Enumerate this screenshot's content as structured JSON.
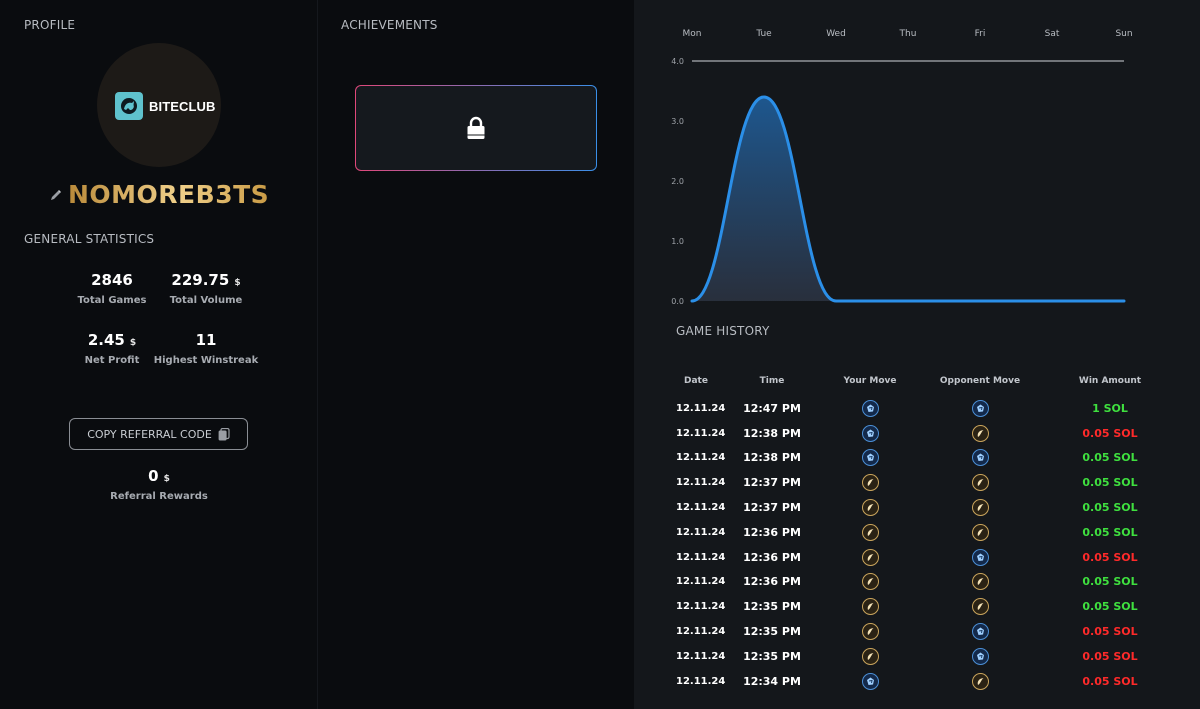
{
  "profile": {
    "section_title": "PROFILE",
    "logo_text": "BITECLUB",
    "username": "NOMOREB3TS",
    "stats_title": "GENERAL STATISTICS",
    "stats": [
      {
        "value": "2846",
        "label": "Total Games",
        "sol": false
      },
      {
        "value": "229.75",
        "label": "Total Volume",
        "sol": true
      },
      {
        "value": "2.45",
        "label": "Net Profit",
        "sol": true
      },
      {
        "value": "11",
        "label": "Highest Winstreak",
        "sol": false
      }
    ],
    "sol_mark": "$",
    "referral_button": "COPY REFERRAL CODE",
    "referral_rewards_value": "0",
    "referral_rewards_label": "Referral Rewards"
  },
  "achievements": {
    "section_title": "ACHIEVEMENTS",
    "cards": [
      {
        "locked": true
      }
    ]
  },
  "chart_data": {
    "type": "area",
    "categories": [
      "Mon",
      "Tue",
      "Wed",
      "Thu",
      "Fri",
      "Sat",
      "Sun"
    ],
    "values": [
      0,
      3.4,
      0,
      0,
      0,
      0,
      0
    ],
    "yticks": [
      "0.0",
      "1.0",
      "2.0",
      "3.0",
      "4.0"
    ],
    "ylim": [
      0,
      4
    ],
    "color": "#2b8fe8"
  },
  "history": {
    "section_title": "GAME HISTORY",
    "headers": [
      "Date",
      "Time",
      "Your Move",
      "Opponent Move",
      "Win Amount"
    ],
    "rows": [
      {
        "date": "12.11.24",
        "time": "12:47 PM",
        "your": "rock",
        "opp": "rock",
        "amount": "1 SOL",
        "win": true
      },
      {
        "date": "12.11.24",
        "time": "12:38 PM",
        "your": "rock",
        "opp": "paper",
        "amount": "0.05 SOL",
        "win": false
      },
      {
        "date": "12.11.24",
        "time": "12:38 PM",
        "your": "rock",
        "opp": "rock",
        "amount": "0.05 SOL",
        "win": true
      },
      {
        "date": "12.11.24",
        "time": "12:37 PM",
        "your": "paper",
        "opp": "paper",
        "amount": "0.05 SOL",
        "win": true
      },
      {
        "date": "12.11.24",
        "time": "12:37 PM",
        "your": "paper",
        "opp": "paper",
        "amount": "0.05 SOL",
        "win": true
      },
      {
        "date": "12.11.24",
        "time": "12:36 PM",
        "your": "paper",
        "opp": "paper",
        "amount": "0.05 SOL",
        "win": true
      },
      {
        "date": "12.11.24",
        "time": "12:36 PM",
        "your": "paper",
        "opp": "rock",
        "amount": "0.05 SOL",
        "win": false
      },
      {
        "date": "12.11.24",
        "time": "12:36 PM",
        "your": "paper",
        "opp": "paper",
        "amount": "0.05 SOL",
        "win": true
      },
      {
        "date": "12.11.24",
        "time": "12:35 PM",
        "your": "paper",
        "opp": "paper",
        "amount": "0.05 SOL",
        "win": true
      },
      {
        "date": "12.11.24",
        "time": "12:35 PM",
        "your": "paper",
        "opp": "rock",
        "amount": "0.05 SOL",
        "win": false
      },
      {
        "date": "12.11.24",
        "time": "12:35 PM",
        "your": "paper",
        "opp": "rock",
        "amount": "0.05 SOL",
        "win": false
      },
      {
        "date": "12.11.24",
        "time": "12:34 PM",
        "your": "rock",
        "opp": "paper",
        "amount": "0.05 SOL",
        "win": false
      }
    ],
    "win_color": "#3fe03f",
    "loss_color": "#ff2a2a"
  }
}
